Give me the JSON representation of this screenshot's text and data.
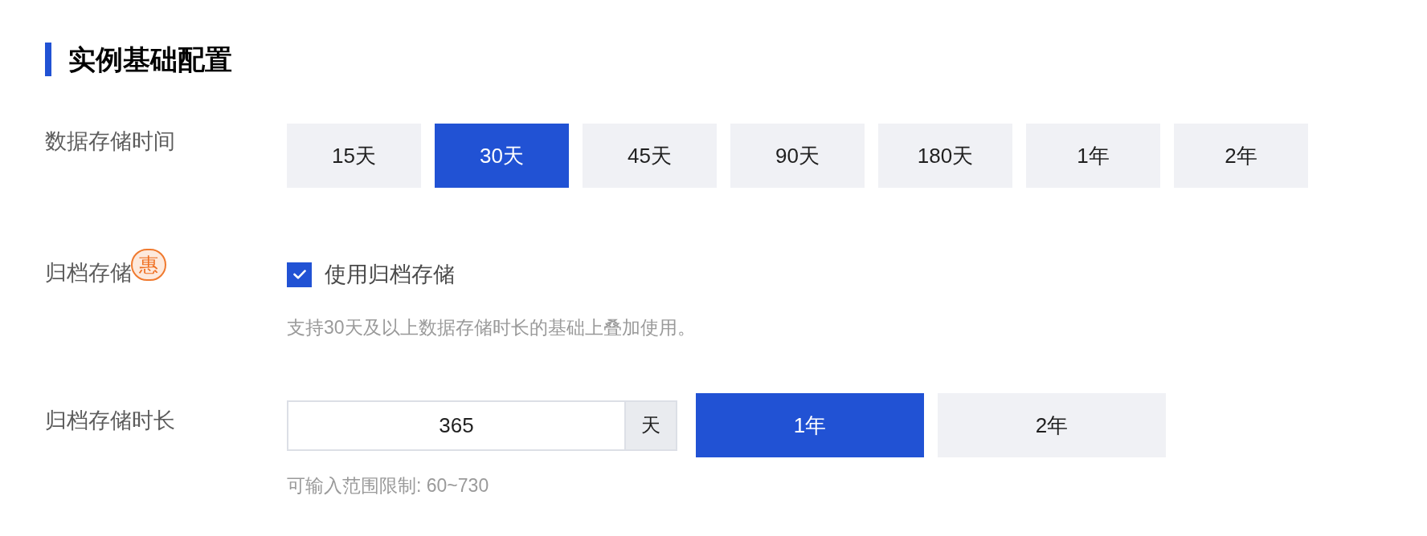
{
  "section": {
    "title": "实例基础配置"
  },
  "retention": {
    "label": "数据存储时间",
    "options": [
      {
        "label": "15天",
        "selected": false
      },
      {
        "label": "30天",
        "selected": true
      },
      {
        "label": "45天",
        "selected": false
      },
      {
        "label": "90天",
        "selected": false
      },
      {
        "label": "180天",
        "selected": false
      },
      {
        "label": "1年",
        "selected": false
      },
      {
        "label": "2年",
        "selected": false
      }
    ]
  },
  "archive": {
    "label": "归档存储",
    "badge": "惠",
    "checkbox": {
      "label": "使用归档存储",
      "checked": true
    },
    "hint": "支持30天及以上数据存储时长的基础上叠加使用。"
  },
  "archive_duration": {
    "label": "归档存储时长",
    "input": {
      "value": "365",
      "unit": "天"
    },
    "options": [
      {
        "label": "1年",
        "selected": true
      },
      {
        "label": "2年",
        "selected": false
      }
    ],
    "hint": "可输入范围限制: 60~730"
  }
}
